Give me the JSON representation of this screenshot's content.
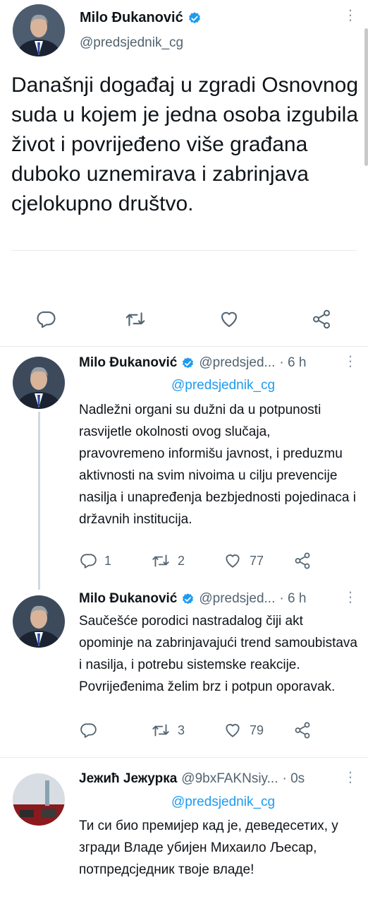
{
  "main_tweet": {
    "name": "Milo Đukanović",
    "handle": "@predsjednik_cg",
    "text": "Današnji događaj u zgradi Osnovnog suda u kojem je jedna osoba izgubila život i povrijeđeno više građana duboko uznemirava i zabrinjava cjelokupno društvo."
  },
  "replies": [
    {
      "name": "Milo Đukanović",
      "handle": "@predsjed...",
      "time": "· 6 h",
      "replying_to": "@predsjednik_cg",
      "text": "Nadležni organi su dužni da u potpunosti rasvijetle okolnosti ovog slučaja, pravovremeno informišu javnost, i preduzmu aktivnosti na svim nivoima u cilju prevencije nasilja i unapređenja bezbjednosti pojedinaca i državnih institucija.",
      "reply_count": "1",
      "retweet_count": "2",
      "like_count": "77"
    },
    {
      "name": "Milo Đukanović",
      "handle": "@predsjed...",
      "time": "· 6 h",
      "text": "Saučešće porodici nastradalog čiji akt opominje na zabrinjavajući trend samoubistava i nasilja, i potrebu sistemske reakcije. Povrijeđenima želim brz i potpun oporavak.",
      "reply_count": "",
      "retweet_count": "3",
      "like_count": "79"
    },
    {
      "name": "Јежић Јежурка",
      "handle": "@9bxFAKNsiy...",
      "time": "· 0s",
      "replying_to": "@predsjednik_cg",
      "text": "Ти си био премијер кад је, деведесетих, у згради Владе убијен Михаило Љесар, потпредсједник твоје владе!"
    }
  ],
  "colors": {
    "accent": "#1d9bf0",
    "muted": "#536471",
    "divider": "#e6ecf0"
  }
}
